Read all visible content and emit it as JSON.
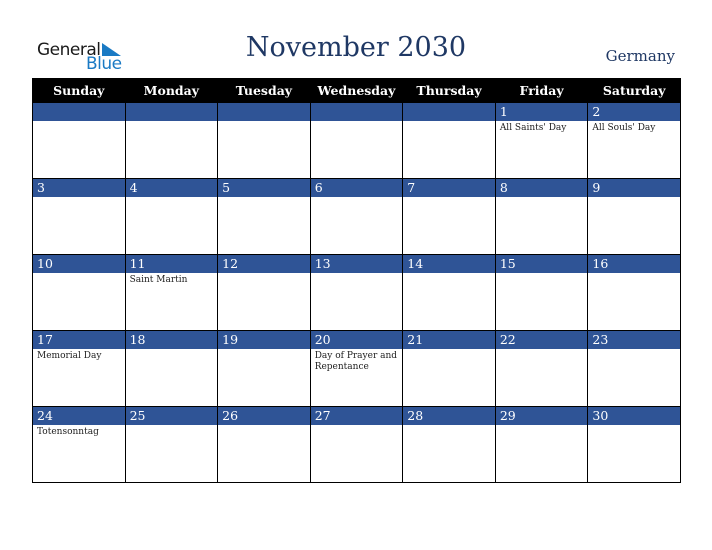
{
  "logo": {
    "line1": "General",
    "line2": "Blue"
  },
  "title": "November 2030",
  "country": "Germany",
  "colors": {
    "accent": "#2f5496",
    "title": "#1f3864",
    "logo_blue": "#1a7ac4",
    "header_bg": "#000000"
  },
  "weekdays": [
    "Sunday",
    "Monday",
    "Tuesday",
    "Wednesday",
    "Thursday",
    "Friday",
    "Saturday"
  ],
  "weeks": [
    [
      {
        "day": "",
        "holiday": ""
      },
      {
        "day": "",
        "holiday": ""
      },
      {
        "day": "",
        "holiday": ""
      },
      {
        "day": "",
        "holiday": ""
      },
      {
        "day": "",
        "holiday": ""
      },
      {
        "day": "1",
        "holiday": "All Saints' Day"
      },
      {
        "day": "2",
        "holiday": "All Souls' Day"
      }
    ],
    [
      {
        "day": "3",
        "holiday": ""
      },
      {
        "day": "4",
        "holiday": ""
      },
      {
        "day": "5",
        "holiday": ""
      },
      {
        "day": "6",
        "holiday": ""
      },
      {
        "day": "7",
        "holiday": ""
      },
      {
        "day": "8",
        "holiday": ""
      },
      {
        "day": "9",
        "holiday": ""
      }
    ],
    [
      {
        "day": "10",
        "holiday": ""
      },
      {
        "day": "11",
        "holiday": "Saint Martin"
      },
      {
        "day": "12",
        "holiday": ""
      },
      {
        "day": "13",
        "holiday": ""
      },
      {
        "day": "14",
        "holiday": ""
      },
      {
        "day": "15",
        "holiday": ""
      },
      {
        "day": "16",
        "holiday": ""
      }
    ],
    [
      {
        "day": "17",
        "holiday": "Memorial Day"
      },
      {
        "day": "18",
        "holiday": ""
      },
      {
        "day": "19",
        "holiday": ""
      },
      {
        "day": "20",
        "holiday": "Day of Prayer and Repentance"
      },
      {
        "day": "21",
        "holiday": ""
      },
      {
        "day": "22",
        "holiday": ""
      },
      {
        "day": "23",
        "holiday": ""
      }
    ],
    [
      {
        "day": "24",
        "holiday": "Totensonntag"
      },
      {
        "day": "25",
        "holiday": ""
      },
      {
        "day": "26",
        "holiday": ""
      },
      {
        "day": "27",
        "holiday": ""
      },
      {
        "day": "28",
        "holiday": ""
      },
      {
        "day": "29",
        "holiday": ""
      },
      {
        "day": "30",
        "holiday": ""
      }
    ]
  ]
}
